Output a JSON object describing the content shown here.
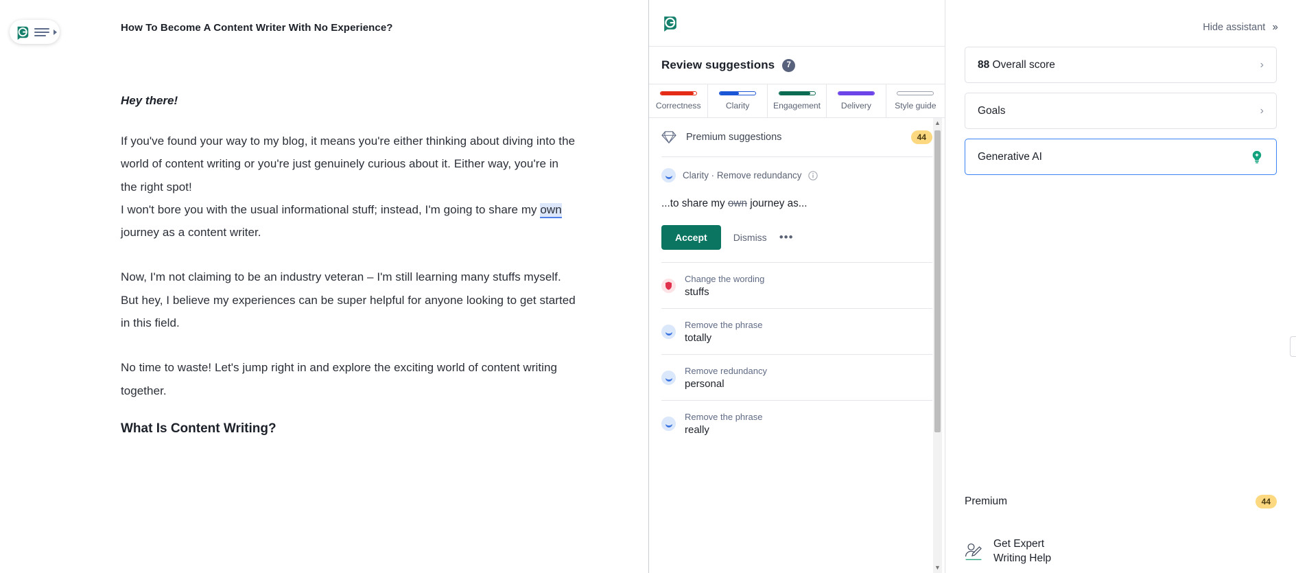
{
  "floating_badge": {
    "logo_icon": "grammarly-logo-icon",
    "menu_icon": "hamburger-menu-icon",
    "caret_icon": "caret-right-icon"
  },
  "document": {
    "title": "How To Become A Content Writer With No Experience?",
    "greeting": "Hey there!",
    "paragraph_1": "If you've found your way to my blog, it means you're either thinking about diving into the world of content writing or you're just genuinely curious about it. Either way, you're in the right spot!",
    "paragraph_2_before": "I won't bore you with the usual informational stuff; instead, I'm going to share my ",
    "highlighted_word": "own",
    "paragraph_2_after": " journey as a content writer.",
    "paragraph_3": "Now, I'm not claiming to be an industry veteran – I'm still learning many stuffs myself. But hey, I believe my experiences can be super helpful for anyone looking to get started in this field.",
    "paragraph_4": "No time to waste! Let's jump right in and explore the exciting world of content writing together.",
    "heading_2": "What Is Content Writing?"
  },
  "assistant": {
    "logo_icon": "grammarly-logo-icon",
    "heading": "Review suggestions",
    "heading_count": "7",
    "tabs": [
      {
        "label": "Correctness",
        "color": "#e32b15",
        "fill_pct": 93,
        "name": "tab-correctness"
      },
      {
        "label": "Clarity",
        "color": "#1a56d6",
        "fill_pct": 54,
        "name": "tab-clarity"
      },
      {
        "label": "Engagement",
        "color": "#0b6b53",
        "fill_pct": 88,
        "name": "tab-engagement"
      },
      {
        "label": "Delivery",
        "color": "#6c44e8",
        "fill_pct": 100,
        "name": "tab-delivery"
      },
      {
        "label": "Style guide",
        "color": "#ffffff",
        "fill_pct": 0,
        "name": "tab-style-guide"
      }
    ],
    "premium_row": {
      "label": "Premium suggestions",
      "badge": "44",
      "icon": "diamond-icon"
    },
    "active_card": {
      "category": "Clarity · Remove redundancy",
      "info_icon": "info-circle-icon",
      "text_before": "...to share my ",
      "text_struck": "own",
      "text_after": " journey as...",
      "accept_label": "Accept",
      "dismiss_label": "Dismiss",
      "more_label": "•••"
    },
    "suggestion_items": [
      {
        "kind": "Change the wording",
        "word": "stuffs",
        "severity": "red"
      },
      {
        "kind": "Remove the phrase",
        "word": "totally",
        "severity": "blue"
      },
      {
        "kind": "Remove redundancy",
        "word": "personal",
        "severity": "blue"
      },
      {
        "kind": "Remove the phrase",
        "word": "really",
        "severity": "blue"
      }
    ],
    "scrollbar": {
      "up_arrow": "▲",
      "down_arrow": "▼"
    }
  },
  "sidebar": {
    "hide_assistant_label": "Hide assistant",
    "hide_assistant_icon": "double-chevron-right-icon",
    "cards": [
      {
        "score": "88",
        "label": " Overall score",
        "name": "overall-score-card",
        "chevron": "›",
        "active": false
      },
      {
        "score": "",
        "label": "Goals",
        "name": "goals-card",
        "chevron": "›",
        "active": false
      },
      {
        "score": "",
        "label": "Generative AI",
        "name": "generative-ai-card",
        "chevron": "",
        "active": true,
        "icon": "lightbulb-icon"
      }
    ],
    "premium_label": "Premium",
    "premium_badge": "44",
    "expert_icon": "person-pen-icon",
    "expert_line1": "Get Expert",
    "expert_line2": "Writing Help"
  },
  "colors": {
    "brand_green": "#0b7561",
    "accent_blue": "#3b82f6",
    "badge_yellow": "#fcd980",
    "highlight_blue": "#dce7fb"
  }
}
